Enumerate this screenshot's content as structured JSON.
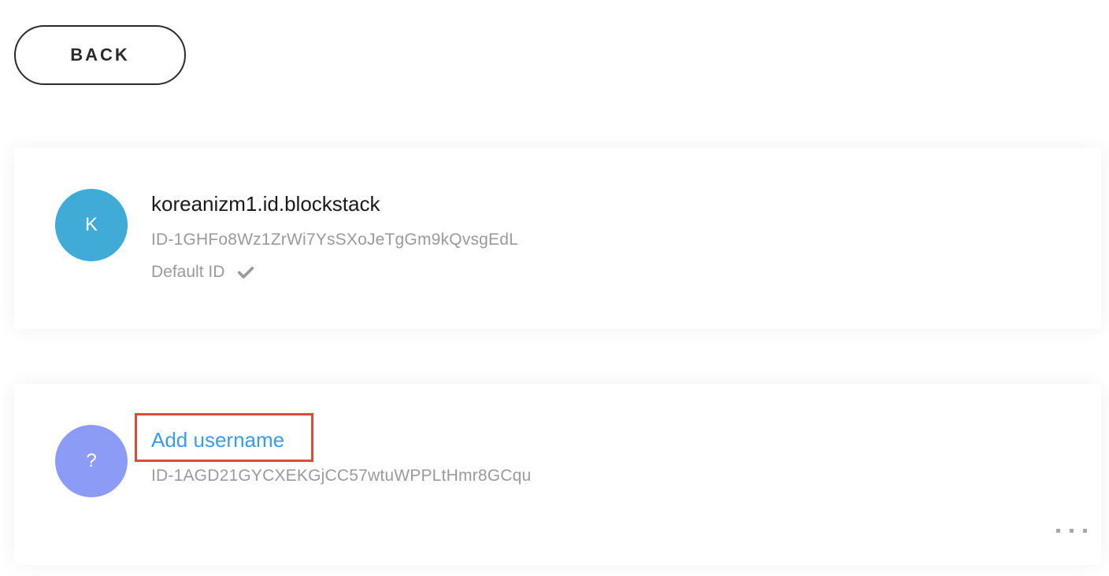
{
  "back_button": {
    "label": "BACK"
  },
  "identities": [
    {
      "avatar_letter": "K",
      "avatar_color": "#3fabd6",
      "username": "koreanizm1.id.blockstack",
      "id": "ID-1GHFo8Wz1ZrWi7YsSXoJeTgGm9kQvsgEdL",
      "default_label": "Default ID",
      "default_icon": "checkmark-icon"
    },
    {
      "avatar_letter": "?",
      "avatar_color": "#8b9bf6",
      "add_username_label": "Add username",
      "id": "ID-1AGD21GYCXEKGjCC57wtuWPPLtHmr8GCqu",
      "more_icon": "more-horizontal-icon",
      "highlight_color": "#e04a35"
    }
  ]
}
